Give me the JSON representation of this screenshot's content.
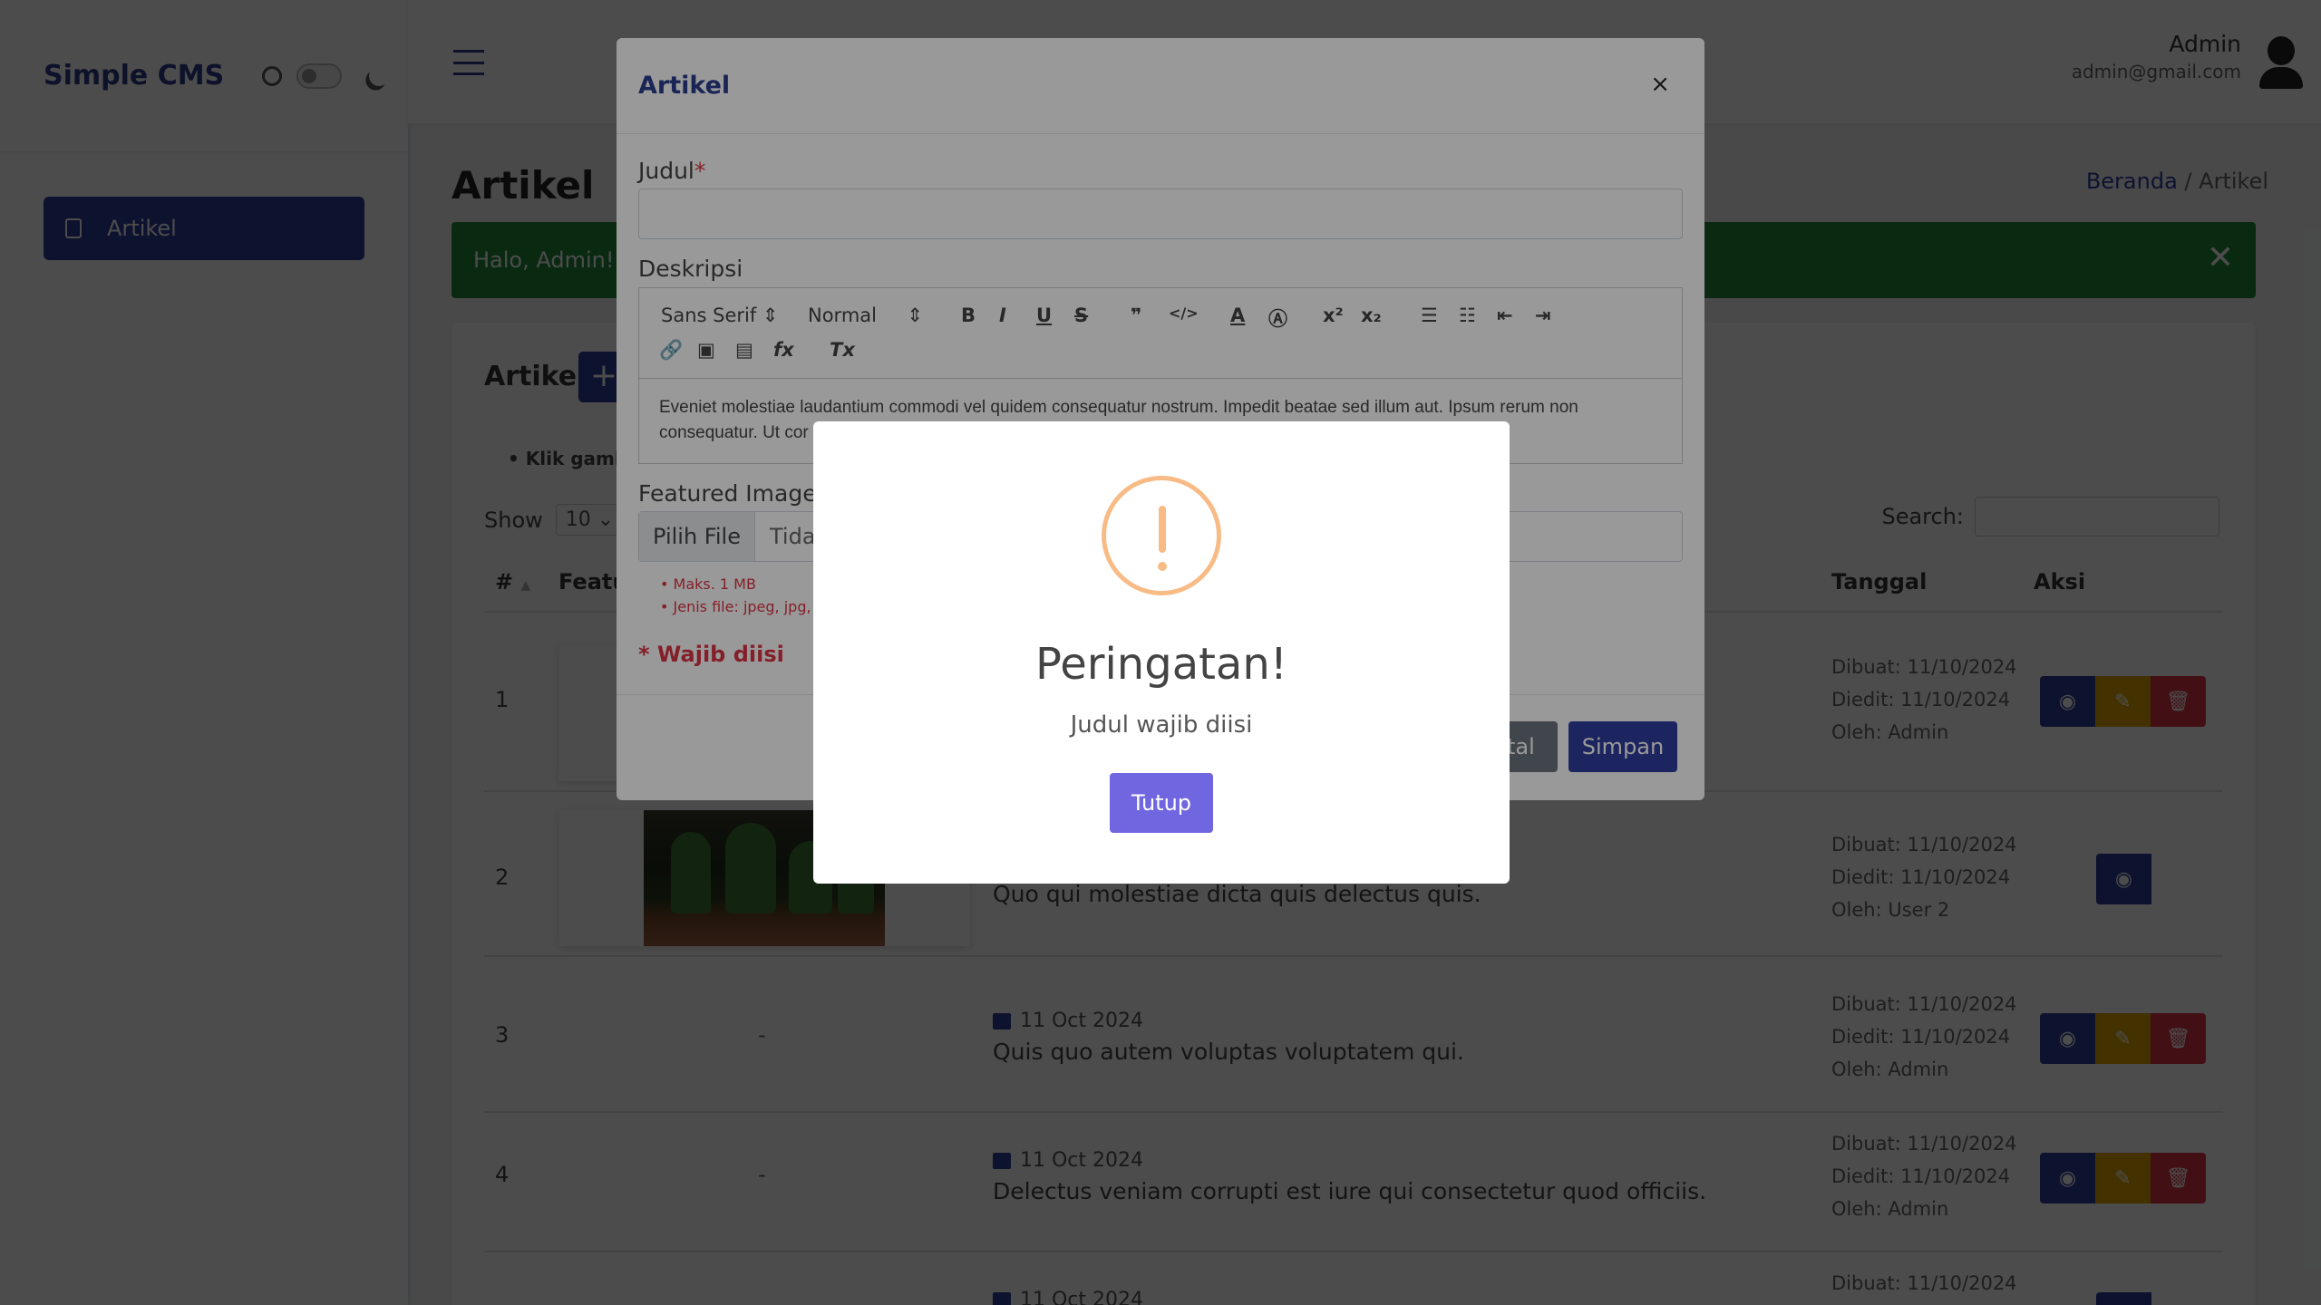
{
  "app": {
    "brand": "Simple CMS"
  },
  "sidebar": {
    "items": [
      {
        "label": "Artikel"
      }
    ]
  },
  "topbar": {
    "user_name": "Admin",
    "user_email": "admin@gmail.com"
  },
  "page": {
    "title": "Artikel",
    "breadcrumb": {
      "home": "Beranda",
      "separator": "/",
      "current": "Artikel"
    },
    "alert": "Halo, Admin!"
  },
  "card": {
    "title": "Artikel",
    "add_label": "+",
    "hint": "Klik gamb",
    "show_label": "Show",
    "show_value": "10",
    "search_label": "Search:",
    "columns": {
      "num": "#",
      "feature": "Featu",
      "date": "Tanggal",
      "action": "Aksi"
    },
    "rows": [
      {
        "no": "1",
        "date": "",
        "title": "",
        "created": "Dibuat: 11/10/2024",
        "edited": "Diedit: 11/10/2024",
        "by": "Oleh: Admin"
      },
      {
        "no": "2",
        "date": "",
        "title": "Quo qui molestiae dicta quis delectus quis.",
        "created": "Dibuat: 11/10/2024",
        "edited": "Diedit: 11/10/2024",
        "by": "Oleh: User 2"
      },
      {
        "no": "3",
        "image": "-",
        "date": "11 Oct 2024",
        "title": "Quis quo autem voluptas voluptatem qui.",
        "created": "Dibuat: 11/10/2024",
        "edited": "Diedit: 11/10/2024",
        "by": "Oleh: Admin"
      },
      {
        "no": "4",
        "image": "-",
        "date": "11 Oct 2024",
        "title": "Delectus veniam corrupti est iure qui consectetur quod officiis.",
        "created": "Dibuat: 11/10/2024",
        "edited": "Diedit: 11/10/2024",
        "by": "Oleh: Admin"
      },
      {
        "no": "",
        "date": "11 Oct 2024",
        "title": "",
        "created": "Dibuat: 11/10/2024",
        "edited": "",
        "by": ""
      }
    ]
  },
  "modal": {
    "title": "Artikel",
    "close": "×",
    "judul_label": "Judul",
    "required_mark": "*",
    "deskripsi_label": "Deskripsi",
    "font_select": "Sans Serif",
    "size_select": "Normal",
    "editor_text": "Eveniet molestiae laudantium commodi vel quidem consequatur nostrum. Impedit beatae sed illum aut. Ipsum rerum non consequatur. Ut cor",
    "featured_label": "Featured Image",
    "file_button": "Pilih File",
    "file_text": "Tida",
    "notes": [
      "Maks. 1 MB",
      "Jenis file: jpeg, jpg,"
    ],
    "required_note": "* Wajib diisi",
    "cancel": "atal",
    "save": "Simpan"
  },
  "dialog": {
    "title": "Peringatan!",
    "message": "Judul wajib diisi",
    "button": "Tutup",
    "icon": "warning-icon",
    "accent": "#f8bb86",
    "button_color": "#7066e0"
  }
}
